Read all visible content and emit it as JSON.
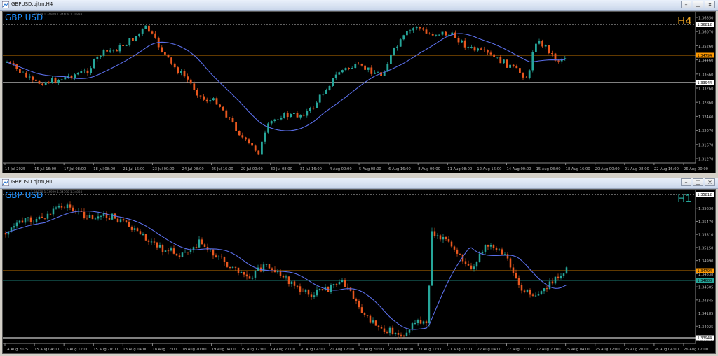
{
  "colors": {
    "bull": "#26a69a",
    "bear": "#e8571e",
    "ma": "#5a6ee8",
    "grid": "#ffffff",
    "accent": "#1e90ff",
    "tf": "#e8a020",
    "hline_orange": "#ff9900",
    "hline_teal": "#26a69a"
  },
  "top": {
    "window_title": "GBPUSD.ojtm,H4",
    "symbol_label": "GBP USD",
    "timeframe_label": "H4",
    "ohlc_info": "1.34629 1.34929 1.34609 1.34838",
    "price_scale": [
      "1.36850",
      "1.36070",
      "1.35260",
      "1.34460",
      "1.33660",
      "1.33260",
      "1.32860",
      "1.32460",
      "1.32070",
      "1.31670",
      "1.31270"
    ],
    "time_labels": [
      "14 Jul 2025",
      "15 Jul 16:00",
      "17 Jul 08:00",
      "18 Jul 08:00",
      "21 Jul 16:00",
      "23 Jul 00:00",
      "24 Jul 08:00",
      "25 Jul 16:00",
      "29 Jul 00:00",
      "30 Jul 08:00",
      "31 Jul 16:00",
      "4 Aug 00:00",
      "5 Aug 08:00",
      "6 Aug 16:00",
      "8 Aug 00:00",
      "11 Aug 08:00",
      "12 Aug 16:00",
      "14 Aug 00:00",
      "15 Aug 08:00",
      "18 Aug 16:00",
      "20 Aug 00:00",
      "21 Aug 08:00",
      "22 Aug 16:00",
      "26 Aug 00:00"
    ],
    "price_tags": {
      "high": "1.36812",
      "current": "1.34794",
      "low": "1.33944"
    },
    "price_min": 1.3115,
    "price_max": 1.3705
  },
  "bottom": {
    "window_title": "GBPUSD.ojtm,H1",
    "symbol_label": "GBP USD",
    "timeframe_label": "H1",
    "ohlc_info": "1.34838 1.34929 1.34790 1.34838",
    "price_scale": [
      "1.35812",
      "1.35630",
      "1.35470",
      "1.35310",
      "1.35150",
      "1.34990",
      "1.34838",
      "1.34605",
      "1.34345",
      "1.34185",
      "1.34025",
      "1.33865"
    ],
    "time_labels": [
      "14 Aug 2025",
      "15 Aug 04:00",
      "15 Aug 12:00",
      "15 Aug 20:00",
      "18 Aug 04:00",
      "18 Aug 12:00",
      "18 Aug 20:00",
      "19 Aug 04:00",
      "19 Aug 12:00",
      "19 Aug 20:00",
      "20 Aug 04:00",
      "20 Aug 12:00",
      "20 Aug 20:00",
      "21 Aug 04:00",
      "21 Aug 12:00",
      "21 Aug 20:00",
      "22 Aug 04:00",
      "22 Aug 12:00",
      "22 Aug 20:00",
      "25 Aug 04:00",
      "25 Aug 12:00",
      "25 Aug 20:00",
      "26 Aug 04:00",
      "26 Aug 12:00"
    ],
    "price_tags": {
      "high": "1.35812",
      "current1": "1.34838",
      "current2": "1.34794",
      "teal": "1.34688",
      "low": "1.33944"
    },
    "price_min": 1.338,
    "price_max": 1.359
  }
}
